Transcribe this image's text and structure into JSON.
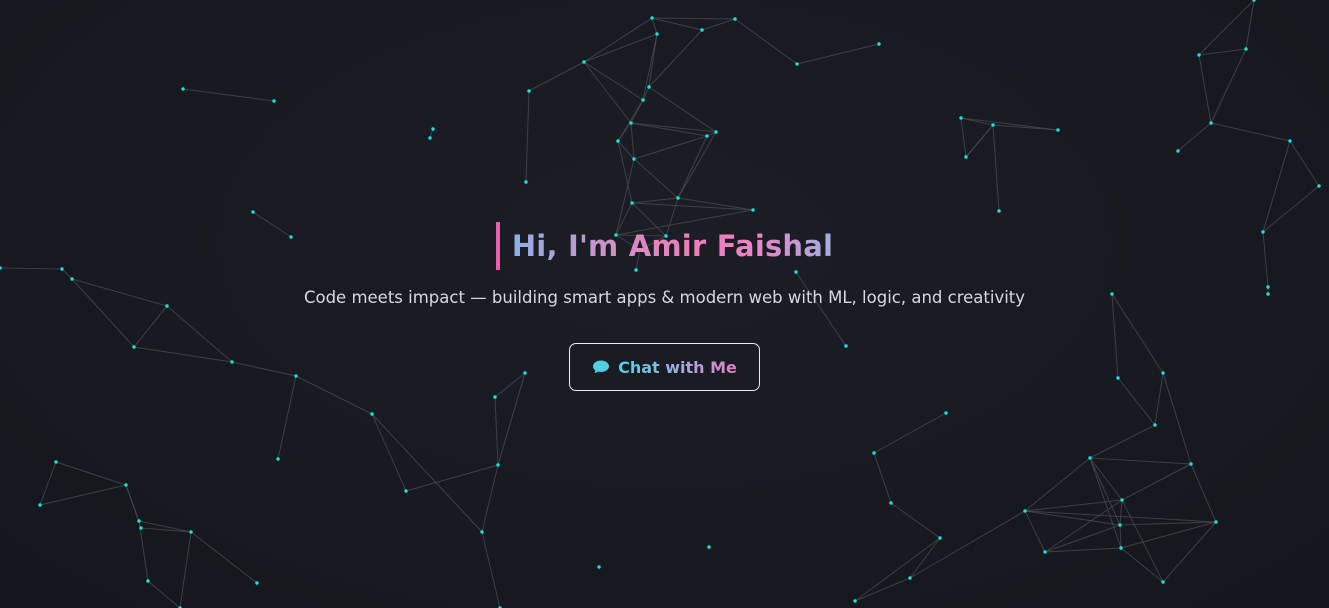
{
  "hero": {
    "greeting": "Hi, I'm Amir Faishal",
    "tagline": "Code meets impact — building smart apps & modern web with ML, logic, and creativity",
    "cta_label": "Chat with Me",
    "cta_icon": "chat-bubble-icon"
  },
  "theme": {
    "background": "#171a21",
    "node_color": "#19e3d8",
    "link_color": "#4a4d52",
    "accent_pink": "#ee5fa8",
    "accent_blue": "#8fb0e8",
    "accent_cyan": "#4fd1e3"
  }
}
